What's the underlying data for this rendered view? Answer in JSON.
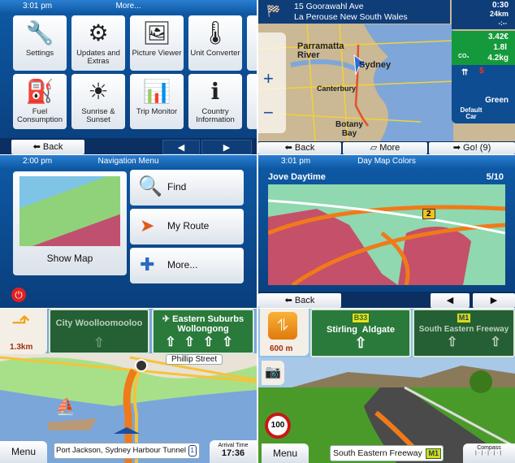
{
  "more_menu": {
    "time": "3:01 pm",
    "title": "More...",
    "tiles": [
      {
        "label": "Settings",
        "icon": "wrench-screwdriver-icon"
      },
      {
        "label": "Updates and Extras",
        "icon": "updates-icon"
      },
      {
        "label": "Picture Viewer",
        "icon": "picture-icon"
      },
      {
        "label": "Unit Converter",
        "icon": "thermometer-icon"
      },
      {
        "label": "Fuel Consumption",
        "icon": "fuel-can-icon"
      },
      {
        "label": "Sunrise & Sunset",
        "icon": "sun-icon"
      },
      {
        "label": "Trip Monitor",
        "icon": "bar-chart-icon"
      },
      {
        "label": "Country Information",
        "icon": "info-icon"
      }
    ],
    "back": "Back",
    "prev": "◀",
    "next": "▶"
  },
  "route_summary": {
    "address1": "15 Goorawahl Ave",
    "address2": "La Perouse New South Wales",
    "time": "0:30",
    "distance": "24km",
    "eta": "-:--",
    "cost": "3.42€",
    "fuel": "1.8l",
    "co2": "4.2kg",
    "co2_label": "CO₂",
    "route_type": "Green",
    "vehicle": "Default Car",
    "map_labels": [
      "Parramatta River",
      "Sydney",
      "Canterbury",
      "Botany Bay"
    ],
    "road_shields": [
      "1",
      "6",
      "66",
      "54",
      "1",
      "3",
      "5",
      "8"
    ],
    "back": "Back",
    "more": "More",
    "go": "Go! (9)"
  },
  "nav_menu": {
    "time": "2:00 pm",
    "title": "Navigation Menu",
    "show_map": "Show Map",
    "find": "Find",
    "my_route": "My Route",
    "more": "More..."
  },
  "map_colors": {
    "time": "3:01 pm",
    "title": "Day Map Colors",
    "scheme": "Jove Daytime",
    "index": "5/10",
    "road_badge": "2",
    "back": "Back",
    "prev": "◀",
    "next": "▶"
  },
  "nav_city": {
    "distance": "1.3km",
    "sign1": "City Woolloomooloo",
    "sign2_line1": "Eastern Suburbs",
    "sign2_line2": "Wollongong",
    "street_bubble": "Phillip Street",
    "menu": "Menu",
    "current_street": "Port Jackson, Sydney Harbour Tunnel",
    "route_shield": "1",
    "arrival_label": "Arrival Time",
    "arrival": "17:36"
  },
  "nav_freeway": {
    "distance": "600 m",
    "sign1_shield": "B33",
    "sign1": "Stirling  Aldgate",
    "sign2_shield": "M1",
    "sign2": "South Eastern Freeway",
    "speed_limit": "100",
    "menu": "Menu",
    "current_street": "South Eastern Freeway",
    "street_shield": "M1",
    "compass": "Compass"
  }
}
